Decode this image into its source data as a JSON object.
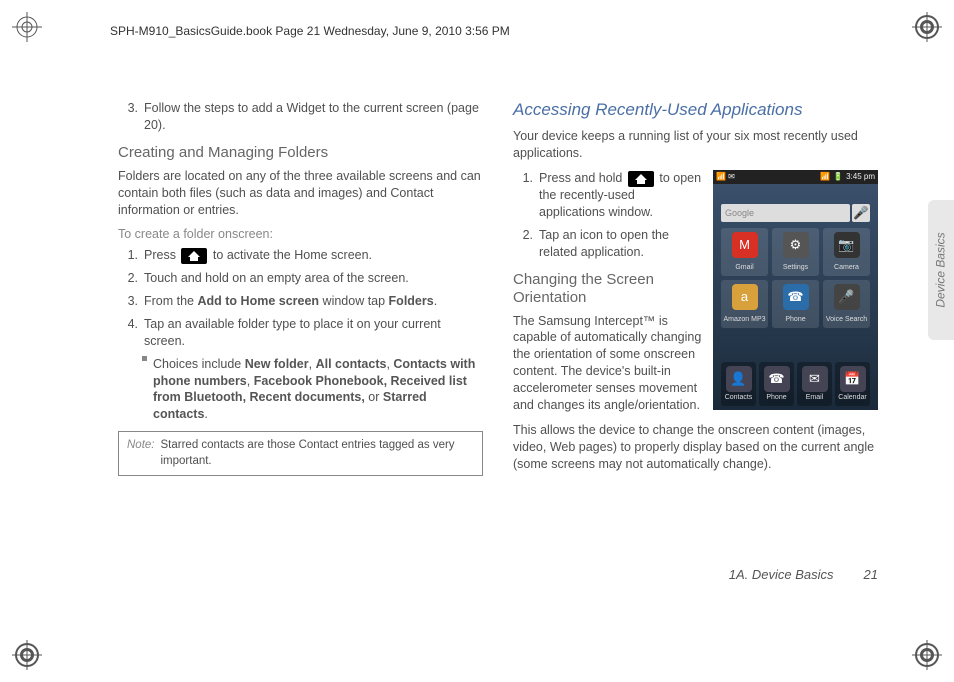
{
  "header": "SPH-M910_BasicsGuide.book  Page 21  Wednesday, June 9, 2010  3:56 PM",
  "side_tab": "Device Basics",
  "footer": {
    "section": "1A. Device Basics",
    "page": "21"
  },
  "left": {
    "step3": {
      "num": "3.",
      "text": "Follow the steps to add a Widget to the current screen (page 20)."
    },
    "h1": "Creating and Managing Folders",
    "p1": "Folders are located on any of the three available screens and can contain both files (such as data and images) and Contact information or entries.",
    "intro": "To create a folder onscreen:",
    "s1": {
      "num": "1.",
      "pre": "Press ",
      "post": " to activate the Home screen."
    },
    "s2": {
      "num": "2.",
      "text": "Touch and hold on an empty area of the screen."
    },
    "s3": {
      "num": "3.",
      "pre": "From the ",
      "b1": "Add to Home screen",
      "mid": " window tap ",
      "b2": "Folders",
      "post": "."
    },
    "s4": {
      "num": "4.",
      "text": "Tap an available folder type to place it on your current screen."
    },
    "bullet": {
      "pre": "Choices include ",
      "b1": "New folder",
      "c1": ", ",
      "b2": "All contacts",
      "c2": ", ",
      "b3": "Contacts with phone numbers",
      "c3": ", ",
      "b4": "Facebook Phonebook, Received list from Bluetooth, Recent documents,",
      "c4": " or ",
      "b5": "Starred contacts",
      "post": "."
    },
    "note": {
      "label": "Note:",
      "text": "Starred contacts are those Contact entries tagged as very important."
    }
  },
  "right": {
    "h1": "Accessing Recently-Used Applications",
    "p1": "Your device keeps a running list of your six most recently used applications.",
    "s1": {
      "num": "1.",
      "pre": "Press and hold ",
      "post": " to open the recently-used applications window."
    },
    "s2": {
      "num": "2.",
      "text": "Tap an icon to open the related application."
    },
    "h2": "Changing the Screen Orientation",
    "p2": "The Samsung Intercept™ is capable of automatically changing the orientation of some onscreen content. The device's built-in accelerometer senses movement and changes its angle/orientation.",
    "p3": "This allows the device to change the onscreen content (images, video, Web pages) to properly display based on the current angle (some screens may not automatically change)."
  },
  "phone": {
    "time": "3:45 pm",
    "search_placeholder": "Google",
    "apps": [
      {
        "name": "Gmail",
        "color": "#d93025",
        "glyph": "M"
      },
      {
        "name": "Settings",
        "color": "#555",
        "glyph": "⚙"
      },
      {
        "name": "Camera",
        "color": "#333",
        "glyph": "📷"
      },
      {
        "name": "Amazon MP3",
        "color": "#d9a13b",
        "glyph": "a"
      },
      {
        "name": "Phone",
        "color": "#2a6da8",
        "glyph": "☎"
      },
      {
        "name": "Voice Search",
        "color": "#444",
        "glyph": "🎤"
      }
    ],
    "dock": [
      {
        "name": "Contacts",
        "glyph": "👤"
      },
      {
        "name": "Phone",
        "glyph": "☎"
      },
      {
        "name": "Email",
        "glyph": "✉"
      },
      {
        "name": "Calendar",
        "glyph": "📅"
      }
    ]
  }
}
